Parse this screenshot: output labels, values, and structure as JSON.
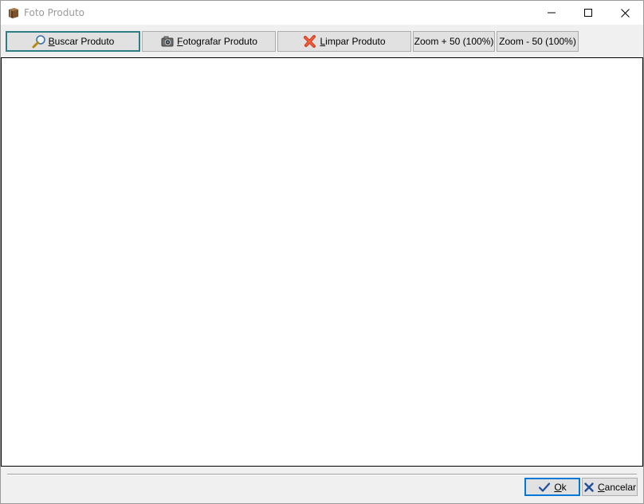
{
  "window": {
    "title": "Foto Produto",
    "app_icon": "box-icon",
    "controls": [
      "minimize-icon",
      "maximize-icon",
      "close-icon"
    ]
  },
  "toolbar": {
    "buscar_label": "Buscar Produto",
    "buscar_icon": "magnifier-icon",
    "fotografar_label": "Fotografar Produto",
    "fotografar_icon": "camera-icon",
    "limpar_label": "Limpar Produto",
    "limpar_icon": "red-x-icon",
    "zoom_in_label": "Zoom + 50 (100%)",
    "zoom_out_label": "Zoom - 50 (100%)"
  },
  "footer": {
    "ok_label": "Ok",
    "ok_icon": "checkmark-icon",
    "cancel_label": "Cancelar",
    "cancel_icon": "cancel-x-icon"
  },
  "colors": {
    "focus_border": "#2e7f83",
    "default_button_border": "#0078d7",
    "button_face": "#e1e1e1",
    "window_bg": "#f0f0f0"
  }
}
